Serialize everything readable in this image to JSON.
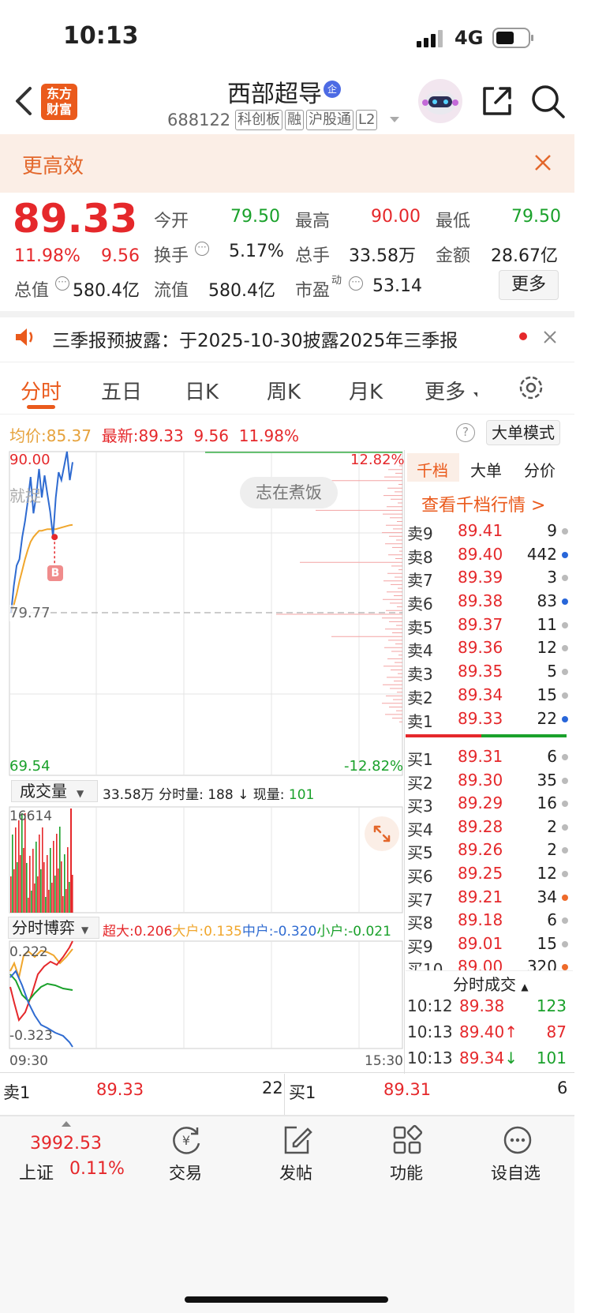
{
  "status": {
    "time": "10:13",
    "network": "4G"
  },
  "header": {
    "logo_line1": "东方",
    "logo_line2": "财富",
    "stock_name": "西部超导",
    "name_badge": "企",
    "code": "688122",
    "tags": [
      "科创板",
      "融",
      "沪股通",
      "L2"
    ]
  },
  "banner": {
    "text": "更高效"
  },
  "quote": {
    "price": "89.33",
    "pct": "11.98%",
    "chg": "9.56",
    "open_label": "今开",
    "open": "79.50",
    "high_label": "最高",
    "high": "90.00",
    "low_label": "最低",
    "low": "79.50",
    "turnover_label": "换手",
    "turnover": "5.17%",
    "volume_label": "总手",
    "volume": "33.58万",
    "amount_label": "金额",
    "amount": "28.67亿",
    "mktcap_label": "总值",
    "mktcap": "580.4亿",
    "float_label": "流值",
    "float": "580.4亿",
    "pe_label": "市盈",
    "pe_sup": "动",
    "pe": "53.14",
    "more_label": "更多"
  },
  "notice": {
    "text": "三季报预披露：于2025-10-30披露2025年三季报"
  },
  "tabs": {
    "items": [
      "分时",
      "五日",
      "日K",
      "周K",
      "月K",
      "更多"
    ],
    "active": 0
  },
  "chart_info": {
    "avg_label": "均价:",
    "avg": "85.37",
    "last_label": "最新:",
    "last": "89.33",
    "chg": "9.56",
    "pct": "11.98%",
    "big_order_mode": "大单模式"
  },
  "chart_data": {
    "type": "line",
    "ylim": [
      69.54,
      90.0
    ],
    "y_top_label": "90.00",
    "y_mid_label": "79.77",
    "y_bottom_label": "69.54",
    "pct_top_label": "12.82%",
    "pct_bottom_label": "-12.82%",
    "watermark": "志在煮饭",
    "left_fragment": "就捉",
    "marker_label": "B",
    "x_start_label": "09:30",
    "x_end_label": "15:30",
    "price_series": [
      79.8,
      81.5,
      82.8,
      83.2,
      84.6,
      85.6,
      86.9,
      88.4,
      86.1,
      87.2,
      88.9,
      87.1,
      88.5,
      87.3,
      86.2,
      84.6,
      87.1,
      88.7,
      88.2,
      89.1,
      90.0,
      88.2,
      89.33
    ],
    "avg_series": [
      79.8,
      80.3,
      81.0,
      81.8,
      82.5,
      83.2,
      83.8,
      84.3,
      84.6,
      84.8,
      85.0,
      85.0,
      85.05,
      85.1,
      85.1,
      85.1,
      85.1,
      85.15,
      85.2,
      85.25,
      85.3,
      85.35,
      85.37
    ]
  },
  "volume_panel": {
    "selector": "成交量",
    "total": "33.58万",
    "minute_label": "分时量:",
    "minute_value": "188",
    "current_label": "现量:",
    "current_value": "101",
    "max_label": "16614"
  },
  "game_panel": {
    "selector": "分时博弈",
    "super_label": "超大:",
    "super": "0.206",
    "big_label": "大户:",
    "big": "0.135",
    "mid_label": "中户:",
    "mid": "-0.320",
    "small_label": "小户:",
    "small": "-0.021",
    "top_label": "0.222",
    "bottom_label": "-0.323"
  },
  "orderbook": {
    "tabs": [
      "千档",
      "大单",
      "分价"
    ],
    "link": "查看千档行情 >",
    "asks": [
      {
        "label": "卖9",
        "price": "89.41",
        "vol": "9",
        "dot": "#bbbbbb"
      },
      {
        "label": "卖8",
        "price": "89.40",
        "vol": "442",
        "dot": "#2866d9"
      },
      {
        "label": "卖7",
        "price": "89.39",
        "vol": "3",
        "dot": "#bbbbbb"
      },
      {
        "label": "卖6",
        "price": "89.38",
        "vol": "83",
        "dot": "#2866d9"
      },
      {
        "label": "卖5",
        "price": "89.37",
        "vol": "11",
        "dot": "#bbbbbb"
      },
      {
        "label": "卖4",
        "price": "89.36",
        "vol": "12",
        "dot": "#bbbbbb"
      },
      {
        "label": "卖3",
        "price": "89.35",
        "vol": "5",
        "dot": "#bbbbbb"
      },
      {
        "label": "卖2",
        "price": "89.34",
        "vol": "15",
        "dot": "#bbbbbb"
      },
      {
        "label": "卖1",
        "price": "89.33",
        "vol": "22",
        "dot": "#2866d9"
      }
    ],
    "bids": [
      {
        "label": "买1",
        "price": "89.31",
        "vol": "6",
        "dot": "#bbbbbb"
      },
      {
        "label": "买2",
        "price": "89.30",
        "vol": "35",
        "dot": "#bbbbbb"
      },
      {
        "label": "买3",
        "price": "89.29",
        "vol": "16",
        "dot": "#bbbbbb"
      },
      {
        "label": "买4",
        "price": "89.28",
        "vol": "2",
        "dot": "#bbbbbb"
      },
      {
        "label": "买5",
        "price": "89.26",
        "vol": "2",
        "dot": "#bbbbbb"
      },
      {
        "label": "买6",
        "price": "89.25",
        "vol": "12",
        "dot": "#bbbbbb"
      },
      {
        "label": "买7",
        "price": "89.21",
        "vol": "34",
        "dot": "#ee6a2a"
      },
      {
        "label": "买8",
        "price": "89.18",
        "vol": "6",
        "dot": "#bbbbbb"
      },
      {
        "label": "买9",
        "price": "89.01",
        "vol": "15",
        "dot": "#bbbbbb"
      },
      {
        "label": "买10",
        "price": "89.00",
        "vol": "320",
        "dot": "#ee6a2a"
      }
    ],
    "trades_title": "分时成交",
    "trades": [
      {
        "time": "10:12",
        "price": "89.38",
        "vol": "123",
        "arrow": "",
        "color": "#1aa12b"
      },
      {
        "time": "10:13",
        "price": "89.40",
        "vol": "87",
        "arrow": "↑",
        "color": "#e5282b"
      },
      {
        "time": "10:13",
        "price": "89.34",
        "vol": "101",
        "arrow": "↓",
        "color": "#1aa12b"
      }
    ]
  },
  "bottom_quote": {
    "ask_label": "卖1",
    "ask_price": "89.33",
    "ask_vol": "22",
    "bid_label": "买1",
    "bid_price": "89.31",
    "bid_vol": "6"
  },
  "nav": {
    "index_value": "3992.53",
    "index_name": "上证",
    "index_pct": "0.11%",
    "items": [
      "交易",
      "发帖",
      "功能",
      "设自选"
    ]
  }
}
